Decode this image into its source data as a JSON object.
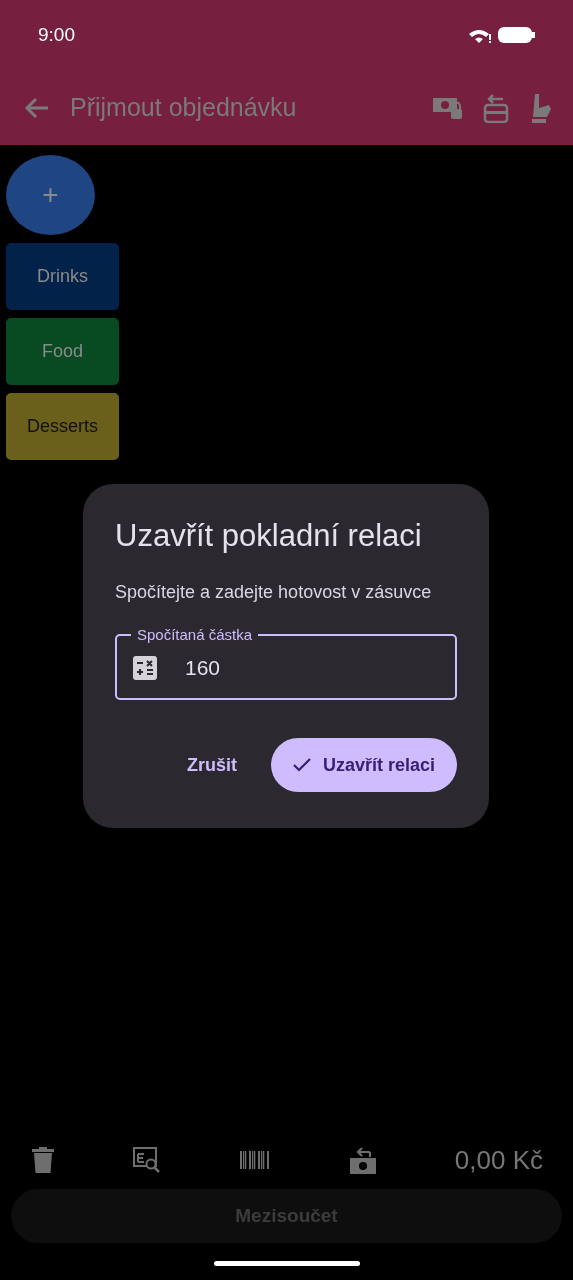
{
  "status_bar": {
    "time": "9:00"
  },
  "app_bar": {
    "title": "Přijmout objednávku"
  },
  "categories": [
    {
      "label": "Drinks",
      "color": "#03224a"
    },
    {
      "label": "Food",
      "color": "#084b23"
    },
    {
      "label": "Desserts",
      "color": "#6b5f1c"
    }
  ],
  "add_button": {
    "label": "+"
  },
  "dialog": {
    "title": "Uzavřít pokladní relaci",
    "message": "Spočítejte a zadejte hotovost v zásuvce",
    "field": {
      "label": "Spočítaná částka",
      "value": "160"
    },
    "buttons": [
      {
        "label": "Zrušit",
        "kind": "text"
      },
      {
        "label": "Uzavřít relaci",
        "kind": "filled"
      }
    ]
  },
  "toolbar": {
    "total": "0,00 Kč"
  },
  "subtotal_button": {
    "label": "Mezisoučet",
    "disabled": true
  }
}
